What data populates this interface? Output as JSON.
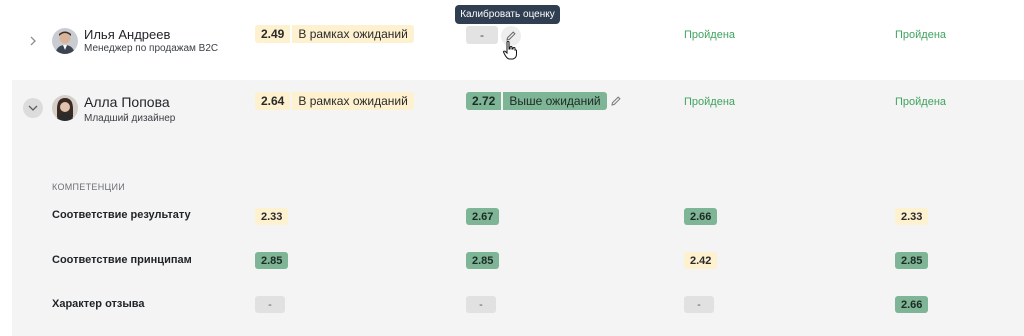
{
  "employees": [
    {
      "name": "Илья Андреев",
      "role": "Менеджер по продажам B2C",
      "self_score": "2.49",
      "self_label": "В рамках ожиданий",
      "calibrated": "-",
      "status1": "Пройдена",
      "status2": "Пройдена",
      "expand_icon": "chevron-right-icon"
    },
    {
      "name": "Алла Попова",
      "role": "Младший дизайнер",
      "self_score": "2.64",
      "self_label": "В рамках ожиданий",
      "calibrated_score": "2.72",
      "calibrated_label": "Выше ожиданий",
      "status1": "Пройдена",
      "status2": "Пройдена",
      "expand_icon": "chevron-down-icon"
    }
  ],
  "tooltip": "Калибровать оценку",
  "competencies": {
    "title": "КОМПЕТЕНЦИИ",
    "rows": [
      {
        "label": "Соответствие результату",
        "values": [
          "2.33",
          "2.67",
          "2.66",
          "2.33"
        ]
      },
      {
        "label": "Соответствие принципам",
        "values": [
          "2.85",
          "2.85",
          "2.42",
          "2.85"
        ]
      },
      {
        "label": "Характер отзыва",
        "values": [
          "-",
          "-",
          "-",
          "2.66"
        ]
      }
    ]
  },
  "colors": {
    "expected": "#fdf1cf",
    "above": "#7db596",
    "passed": "#3fa35f",
    "tooltip_bg": "#2f3e50"
  }
}
